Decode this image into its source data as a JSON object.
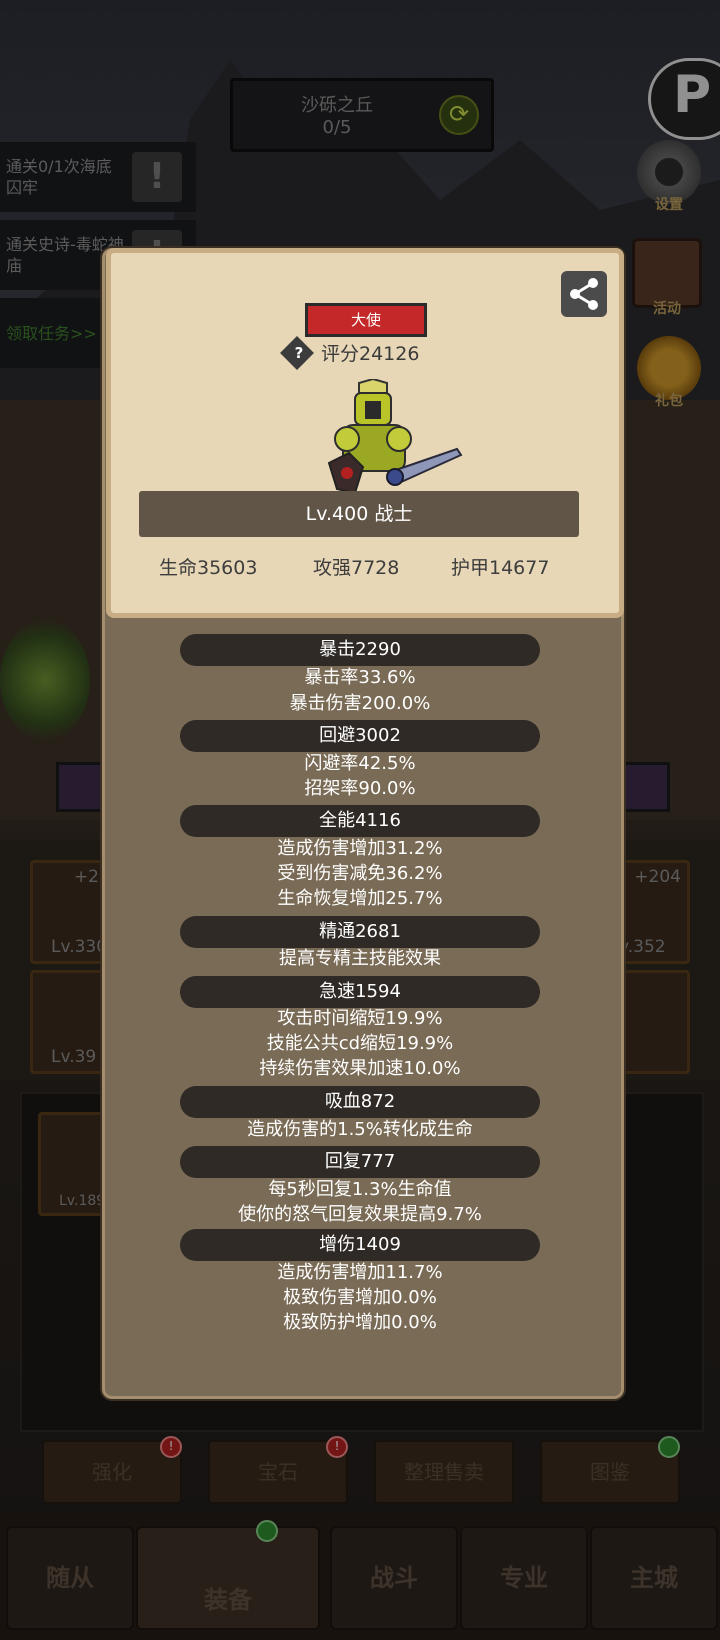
{
  "stage": {
    "name": "沙砾之丘",
    "progress": "0/5"
  },
  "quests": [
    {
      "text": "通关0/1次海底囚牢"
    },
    {
      "text": "通关史诗-毒蛇神庙"
    },
    {
      "link": "领取任务>>"
    }
  ],
  "side_menu": {
    "settings": "设置",
    "activity": "活动",
    "gift": "礼包"
  },
  "card": {
    "title": "大使",
    "score": "评分24126",
    "level_class": "Lv.400 战士",
    "stats": {
      "hp": "生命35603",
      "attack": "攻强7728",
      "armor": "护甲14677"
    }
  },
  "attributes": [
    {
      "header": "暴击2290",
      "lines": [
        "暴击率33.6%",
        "暴击伤害200.0%"
      ]
    },
    {
      "header": "回避3002",
      "lines": [
        "闪避率42.5%",
        "招架率90.0%"
      ]
    },
    {
      "header": "全能4116",
      "lines": [
        "造成伤害增加31.2%",
        "受到伤害减免36.2%",
        "生命恢复增加25.7%"
      ]
    },
    {
      "header": "精通2681",
      "lines": [
        "提高专精主技能效果"
      ]
    },
    {
      "header": "急速1594",
      "lines": [
        "攻击时间缩短19.9%",
        "技能公共cd缩短19.9%",
        "持续伤害效果加速10.0%"
      ]
    },
    {
      "header": "吸血872",
      "lines": [
        "造成伤害的1.5%转化成生命"
      ]
    },
    {
      "header": "回复777",
      "lines": [
        "每5秒回复1.3%生命值",
        "使你的怒气回复效果提高9.7%"
      ]
    },
    {
      "header": "增伤1409",
      "lines": [
        "造成伤害增加11.7%",
        "极致伤害增加0.0%",
        "极致防护增加0.0%"
      ]
    }
  ],
  "equipment": {
    "left_top": {
      "plus": "+2",
      "level": "Lv.330"
    },
    "left_mid": {
      "level": "Lv.39"
    },
    "left_bottom": {
      "level": "Lv.189"
    },
    "right_top": {
      "plus": "+204",
      "level": "v.352"
    }
  },
  "actions": {
    "enhance": "强化",
    "gem": "宝石",
    "sell": "整理售卖",
    "codex": "图鉴"
  },
  "nav": {
    "follower": "随从",
    "equip": "装备",
    "battle": "战斗",
    "profession": "专业",
    "city": "主城"
  },
  "colors": {
    "title_badge": "#c42828",
    "card_bg": "#e7d7b6",
    "panel_bg": "#7a6b56"
  }
}
